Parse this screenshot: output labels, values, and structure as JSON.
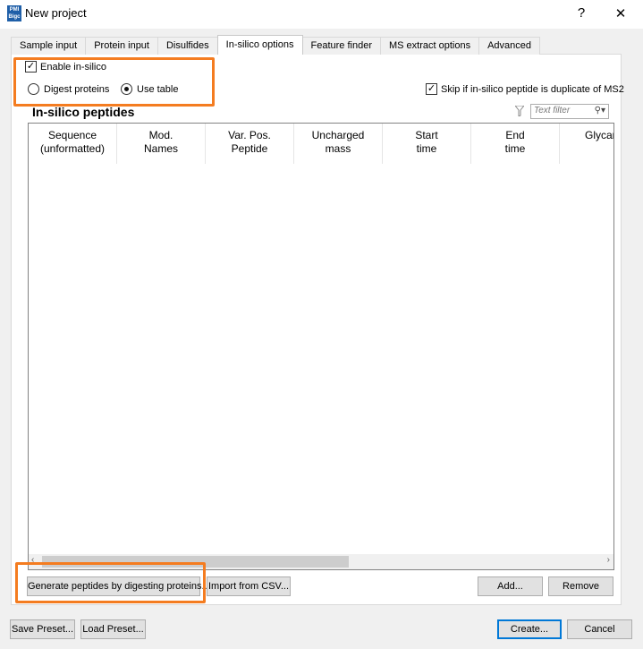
{
  "window": {
    "title": "New project",
    "app_icon_text": "PMI Bigc",
    "help_label": "?",
    "close_label": "✕"
  },
  "tabs": [
    {
      "label": "Sample input"
    },
    {
      "label": "Protein input"
    },
    {
      "label": "Disulfides"
    },
    {
      "label": "In-silico options"
    },
    {
      "label": "Feature finder"
    },
    {
      "label": "MS extract options"
    },
    {
      "label": "Advanced"
    }
  ],
  "insilico": {
    "enable_label": "Enable in-silico",
    "enable_checked": true,
    "digest_label": "Digest proteins",
    "use_table_label": "Use table",
    "selected_mode": "use_table",
    "skip_label": "Skip if in-silico peptide is duplicate of MS2",
    "skip_checked": true
  },
  "peptides": {
    "title": "In-silico peptides",
    "filter_placeholder": "Text filter",
    "columns": [
      {
        "line1": "Sequence",
        "line2": "(unformatted)"
      },
      {
        "line1": "Mod.",
        "line2": "Names"
      },
      {
        "line1": "Var. Pos.",
        "line2": "Peptide"
      },
      {
        "line1": "Uncharged",
        "line2": "mass"
      },
      {
        "line1": "Start",
        "line2": "time"
      },
      {
        "line1": "End",
        "line2": "time"
      },
      {
        "line1": "Glycan",
        "line2": ""
      }
    ],
    "rows": []
  },
  "table_buttons": {
    "generate": "Generate peptides by digesting proteins...",
    "import": "Import from CSV...",
    "add": "Add...",
    "remove": "Remove"
  },
  "footer": {
    "save_preset": "Save Preset...",
    "load_preset": "Load Preset...",
    "create": "Create...",
    "cancel": "Cancel"
  },
  "colors": {
    "highlight": "#f47c20",
    "accent": "#0078d7"
  }
}
